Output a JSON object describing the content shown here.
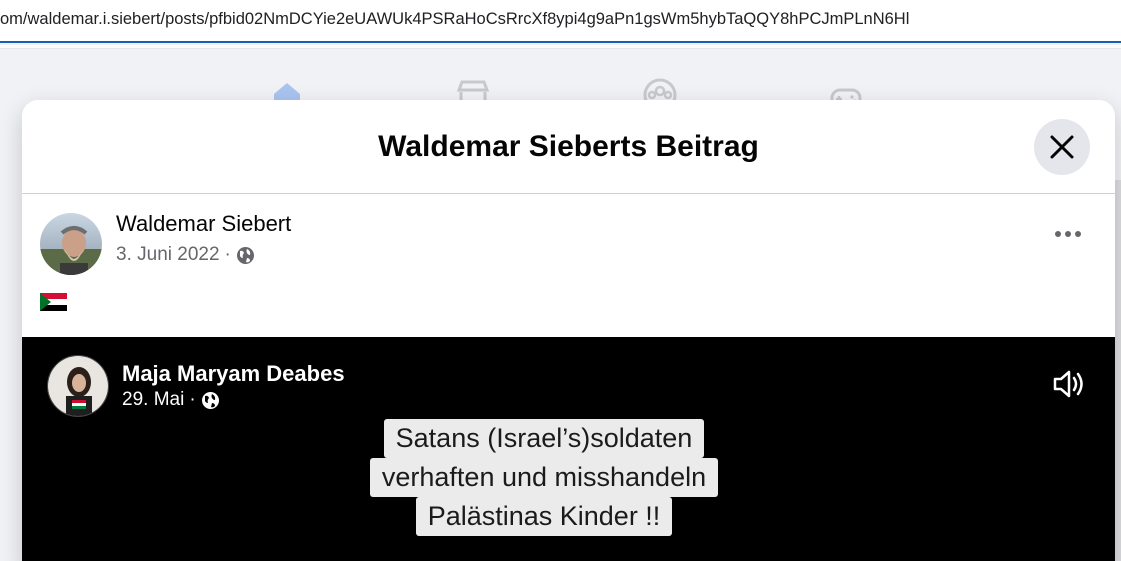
{
  "browser": {
    "url": "om/waldemar.i.siebert/posts/pfbid02NmDCYie2eUAWUk4PSRaHoCsRrcXf8ypi4g9aPn1gsWm5hybTaQQY8hPCJmPLnN6Hl"
  },
  "background_nav": {
    "items": [
      "home-icon",
      "marketplace-icon",
      "groups-icon",
      "gaming-icon"
    ],
    "active_color": "#1877f2"
  },
  "modal": {
    "title": "Waldemar Sieberts Beitrag",
    "close_icon": "close-icon"
  },
  "post": {
    "author": "Waldemar Siebert",
    "date": "3. Juni 2022",
    "separator": "·",
    "audience_icon": "globe-icon",
    "body_flag": "sudan-flag-emoji"
  },
  "shared_video": {
    "author": "Maja Maryam Deabes",
    "date": "29. Mai",
    "separator": "·",
    "audience_icon": "globe-icon",
    "volume_icon": "volume-icon",
    "caption_lines": [
      "Satans (Israel’s)soldaten",
      "verhaften und misshandeln",
      "Palästinas Kinder !!"
    ]
  }
}
